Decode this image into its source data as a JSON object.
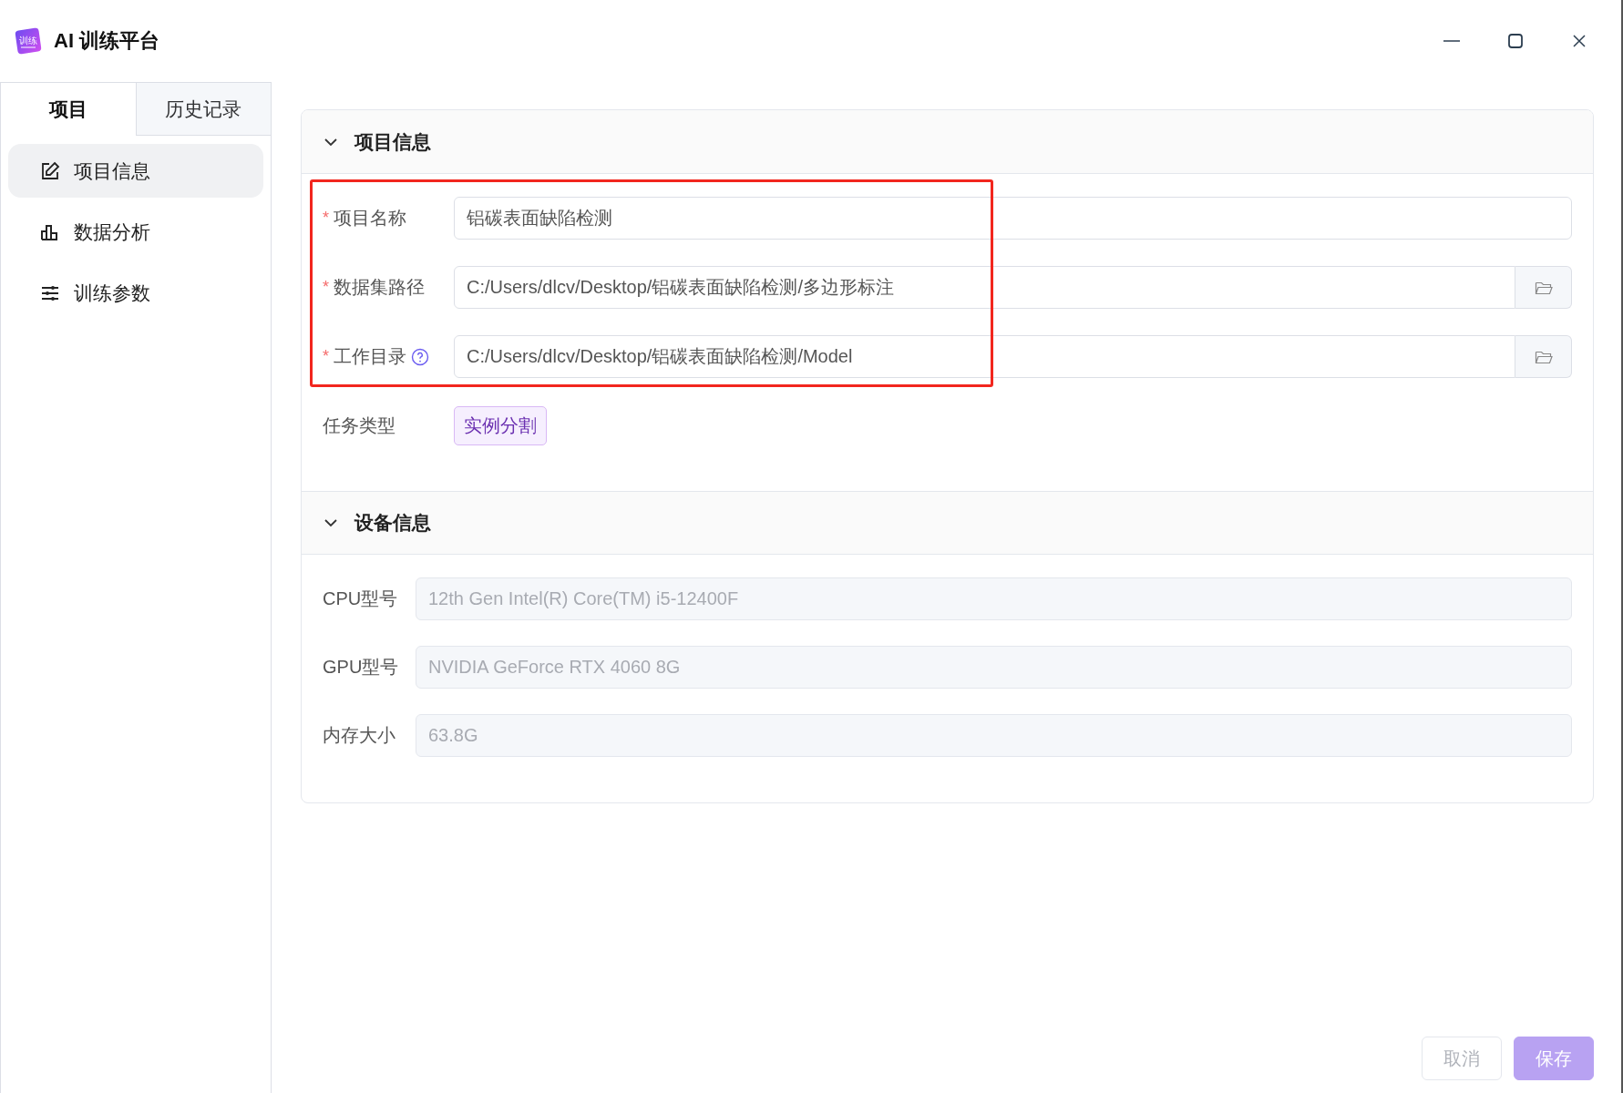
{
  "window": {
    "title": "AI 训练平台",
    "logo_text": "训练"
  },
  "sidebar": {
    "tabs": [
      {
        "label": "项目",
        "selected": true
      },
      {
        "label": "历史记录",
        "selected": false
      }
    ],
    "items": [
      {
        "label": "项目信息",
        "selected": true
      },
      {
        "label": "数据分析",
        "selected": false
      },
      {
        "label": "训练参数",
        "selected": false
      }
    ]
  },
  "sections": [
    {
      "title": "项目信息",
      "expanded": true,
      "fields": [
        {
          "kind": "input",
          "required_mark": "*",
          "label": "项目名称",
          "help": false,
          "value": "铝碳表面缺陷检测"
        },
        {
          "kind": "path",
          "required_mark": "*",
          "label": "数据集路径",
          "help": false,
          "value": "C:/Users/dlcv/Desktop/铝碳表面缺陷检测/多边形标注"
        },
        {
          "kind": "path",
          "required_mark": "*",
          "label": "工作目录",
          "help": true,
          "value": "C:/Users/dlcv/Desktop/铝碳表面缺陷检测/Model"
        },
        {
          "kind": "tag",
          "label": "任务类型",
          "help": false,
          "value": "实例分割"
        }
      ]
    },
    {
      "title": "设备信息",
      "expanded": true,
      "fields": [
        {
          "kind": "readonly",
          "label": "CPU型号",
          "value": "12th Gen Intel(R) Core(TM) i5-12400F"
        },
        {
          "kind": "readonly",
          "label": "GPU型号",
          "value": "NVIDIA GeForce RTX 4060 8G"
        },
        {
          "kind": "readonly",
          "label": "内存大小",
          "value": "63.8G"
        }
      ]
    }
  ],
  "buttons": [
    {
      "label": "取消",
      "kind": "secondary"
    },
    {
      "label": "保存",
      "kind": "primary"
    }
  ]
}
